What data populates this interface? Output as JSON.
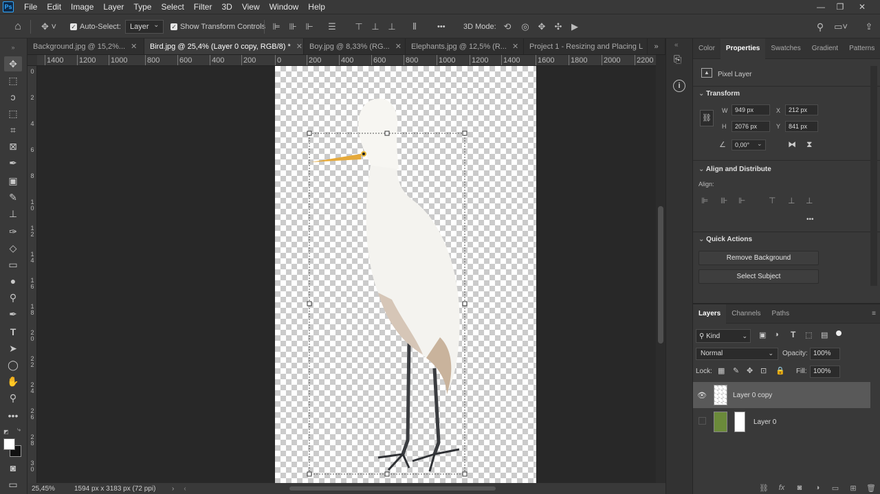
{
  "menu": {
    "items": [
      "File",
      "Edit",
      "Image",
      "Layer",
      "Type",
      "Select",
      "Filter",
      "3D",
      "View",
      "Window",
      "Help"
    ]
  },
  "options": {
    "auto_select_label": "Auto-Select:",
    "auto_select_value": "Layer",
    "show_transform_label": "Show Transform Controls",
    "mode_3d_label": "3D Mode:",
    "more": "•••"
  },
  "tabs": [
    {
      "label": "Background.jpg @ 15,2%..."
    },
    {
      "label": "Bird.jpg @ 25,4% (Layer 0 copy, RGB/8) *"
    },
    {
      "label": "Boy.jpg @ 8,33% (RG..."
    },
    {
      "label": "Elephants.jpg @ 12,5% (R..."
    },
    {
      "label": "Project 1 - Resizing and Placing L"
    }
  ],
  "ruler": {
    "h": [
      "1400",
      "1200",
      "1000",
      "800",
      "600",
      "400",
      "200",
      "0",
      "200",
      "400",
      "600",
      "800",
      "1000",
      "1200",
      "1400",
      "1600",
      "1800",
      "2000",
      "2200"
    ],
    "v": [
      "0",
      "2",
      "4",
      "6",
      "8",
      "10",
      "12",
      "14",
      "16",
      "18",
      "20",
      "22",
      "24",
      "26",
      "28",
      "30"
    ]
  },
  "status": {
    "zoom": "25,45%",
    "doc_size": "1594 px x 3183 px (72 ppi)"
  },
  "properties": {
    "tabs": [
      "Color",
      "Properties",
      "Swatches",
      "Gradient",
      "Patterns"
    ],
    "layer_type": "Pixel Layer",
    "transform_title": "Transform",
    "w_label": "W",
    "w": "949 px",
    "h_label": "H",
    "h": "2076 px",
    "x_label": "X",
    "x": "212 px",
    "y_label": "Y",
    "y": "841 px",
    "angle": "0,00°",
    "align_title": "Align and Distribute",
    "align_label": "Align:",
    "more": "•••",
    "quick_title": "Quick Actions",
    "remove_bg": "Remove Background",
    "select_subject": "Select Subject"
  },
  "layers_panel": {
    "tabs": [
      "Layers",
      "Channels",
      "Paths"
    ],
    "filter": "Kind",
    "blend": "Normal",
    "opacity_label": "Opacity:",
    "opacity": "100%",
    "lock_label": "Lock:",
    "fill_label": "Fill:",
    "fill": "100%",
    "layers": [
      {
        "name": "Layer 0 copy"
      },
      {
        "name": "Layer 0"
      }
    ]
  }
}
